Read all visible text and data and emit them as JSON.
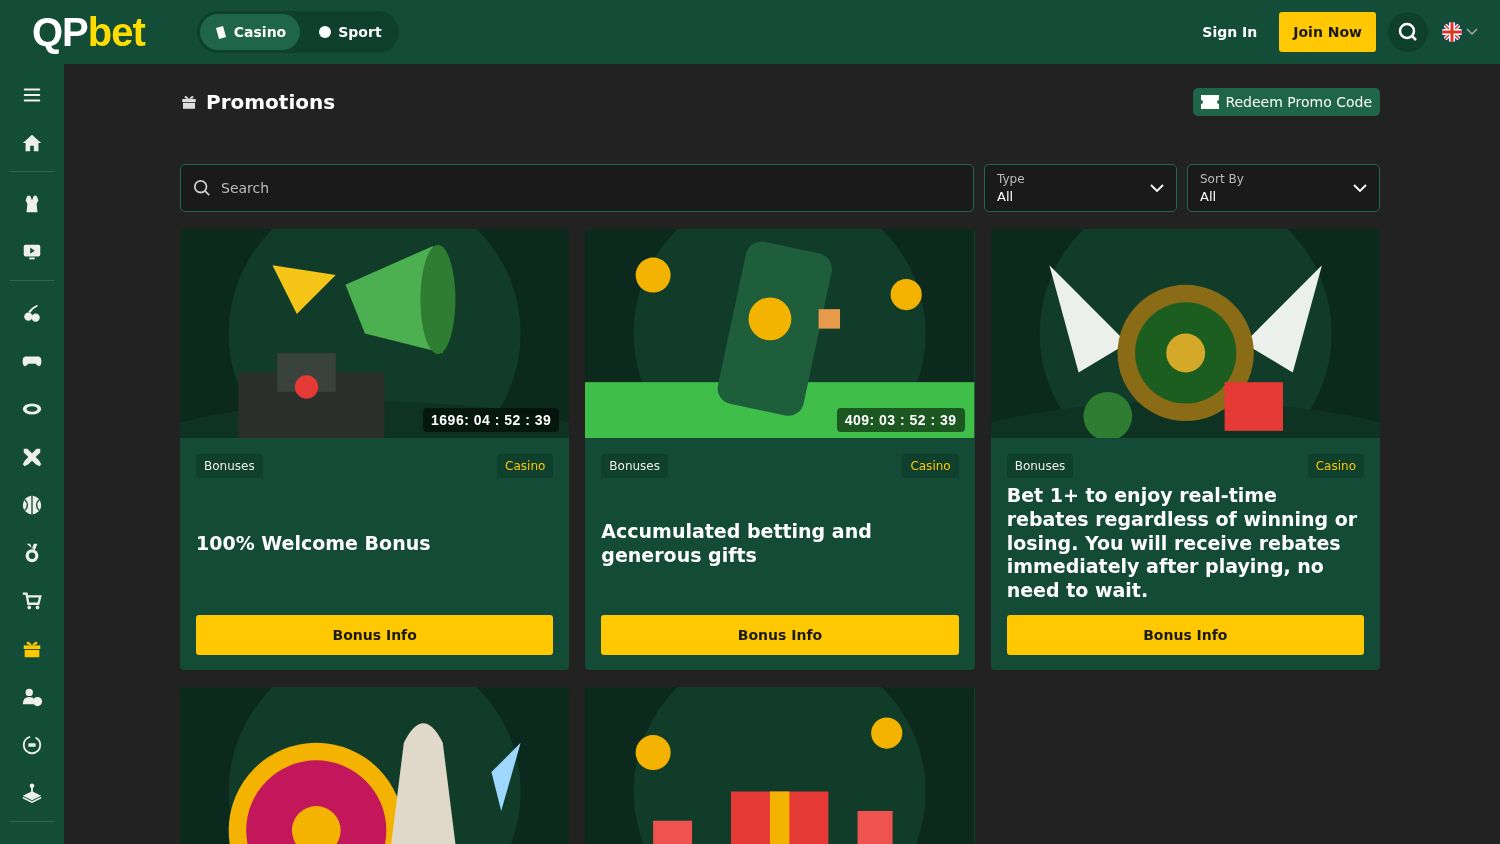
{
  "header": {
    "logo": {
      "part_1": "QP",
      "part_2": "bet"
    },
    "tabs": [
      {
        "label": "Casino",
        "selected": true
      },
      {
        "label": "Sport",
        "selected": false
      }
    ],
    "sign_in": "Sign In",
    "join": "Join Now"
  },
  "sidebar": {
    "sections": [
      {
        "items": [
          {
            "selected": false
          },
          {
            "selected": false
          }
        ]
      },
      {
        "items": [
          {
            "selected": false
          },
          {
            "selected": false
          }
        ]
      },
      {
        "items": [
          {
            "selected": false
          },
          {
            "selected": false
          },
          {
            "selected": false
          },
          {
            "selected": false
          },
          {
            "selected": false
          },
          {
            "selected": false
          },
          {
            "selected": false
          },
          {
            "selected": true
          },
          {
            "selected": false
          },
          {
            "selected": false
          },
          {
            "selected": false
          }
        ]
      }
    ]
  },
  "page": {
    "title": "Promotions",
    "redeem": "Redeem Promo Code",
    "search": {
      "placeholder": "Search"
    },
    "filters": [
      {
        "label": "Type",
        "value": "All"
      },
      {
        "label": "Sort By",
        "value": "All"
      }
    ],
    "cards": [
      {
        "kind": "picture",
        "timer": "1696: 04 : 52 : 39",
        "tag": "Bonuses",
        "category": "Casino",
        "title": "100% Welcome Bonus",
        "button": "Bonus Info"
      },
      {
        "kind": "picture",
        "timer": "409: 03 : 52 : 39",
        "tag": "Bonuses",
        "category": "Casino",
        "title": "Accumulated betting and generous gifts",
        "button": "Bonus Info"
      },
      {
        "kind": "picture",
        "tag": "Bonuses",
        "category": "Casino",
        "title": "Bet 1+ to enjoy real-time rebates regardless of winning or losing. You will receive rebates immediately after playing, no need to wait.",
        "button": "Bonus Info"
      },
      {
        "kind": "picture"
      },
      {
        "kind": "picture"
      }
    ]
  }
}
